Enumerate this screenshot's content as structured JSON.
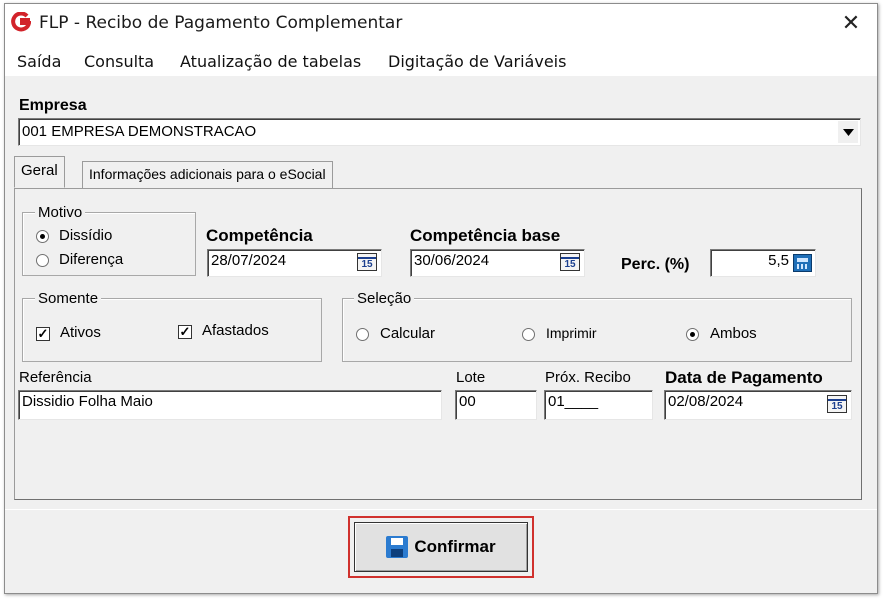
{
  "window": {
    "title": "FLP - Recibo de Pagamento Complementar",
    "close_label": "✕"
  },
  "menu": [
    "Saída",
    "Consulta",
    "Atualização de tabelas",
    "Digitação de Variáveis"
  ],
  "empresa": {
    "label": "Empresa",
    "value": "001 EMPRESA DEMONSTRACAO"
  },
  "tabs": [
    {
      "label": "Geral",
      "active": true
    },
    {
      "label": "Informações adicionais para o eSocial",
      "active": false
    }
  ],
  "motivo": {
    "title": "Motivo",
    "options": [
      {
        "label": "Dissídio",
        "selected": true
      },
      {
        "label": "Diferença",
        "selected": false
      }
    ]
  },
  "competencia": {
    "label": "Competência",
    "value": "28/07/2024"
  },
  "competencia_base": {
    "label": "Competência base",
    "value": "30/06/2024"
  },
  "perc": {
    "label": "Perc. (%)",
    "value": "5,5"
  },
  "somente": {
    "title": "Somente",
    "options": [
      {
        "label": "Ativos",
        "checked": true
      },
      {
        "label": "Afastados",
        "checked": true
      }
    ]
  },
  "selecao": {
    "title": "Seleção",
    "options": [
      {
        "label": "Calcular",
        "selected": false
      },
      {
        "label": "Imprimir",
        "selected": false
      },
      {
        "label": "Ambos",
        "selected": true
      }
    ]
  },
  "referencia": {
    "label": "Referência",
    "value": "Dissidio Folha Maio"
  },
  "lote": {
    "label": "Lote",
    "value": "00"
  },
  "prox_recibo": {
    "label": "Próx. Recibo",
    "value": "01____"
  },
  "data_pagamento": {
    "label": "Data de Pagamento",
    "value": "02/08/2024"
  },
  "calendar_glyph": "15",
  "confirm": {
    "label": "Confirmar"
  },
  "colors": {
    "highlight_border": "#d0312d",
    "calendar_blue": "#1b3f8f",
    "logo_red": "#d2232a"
  }
}
